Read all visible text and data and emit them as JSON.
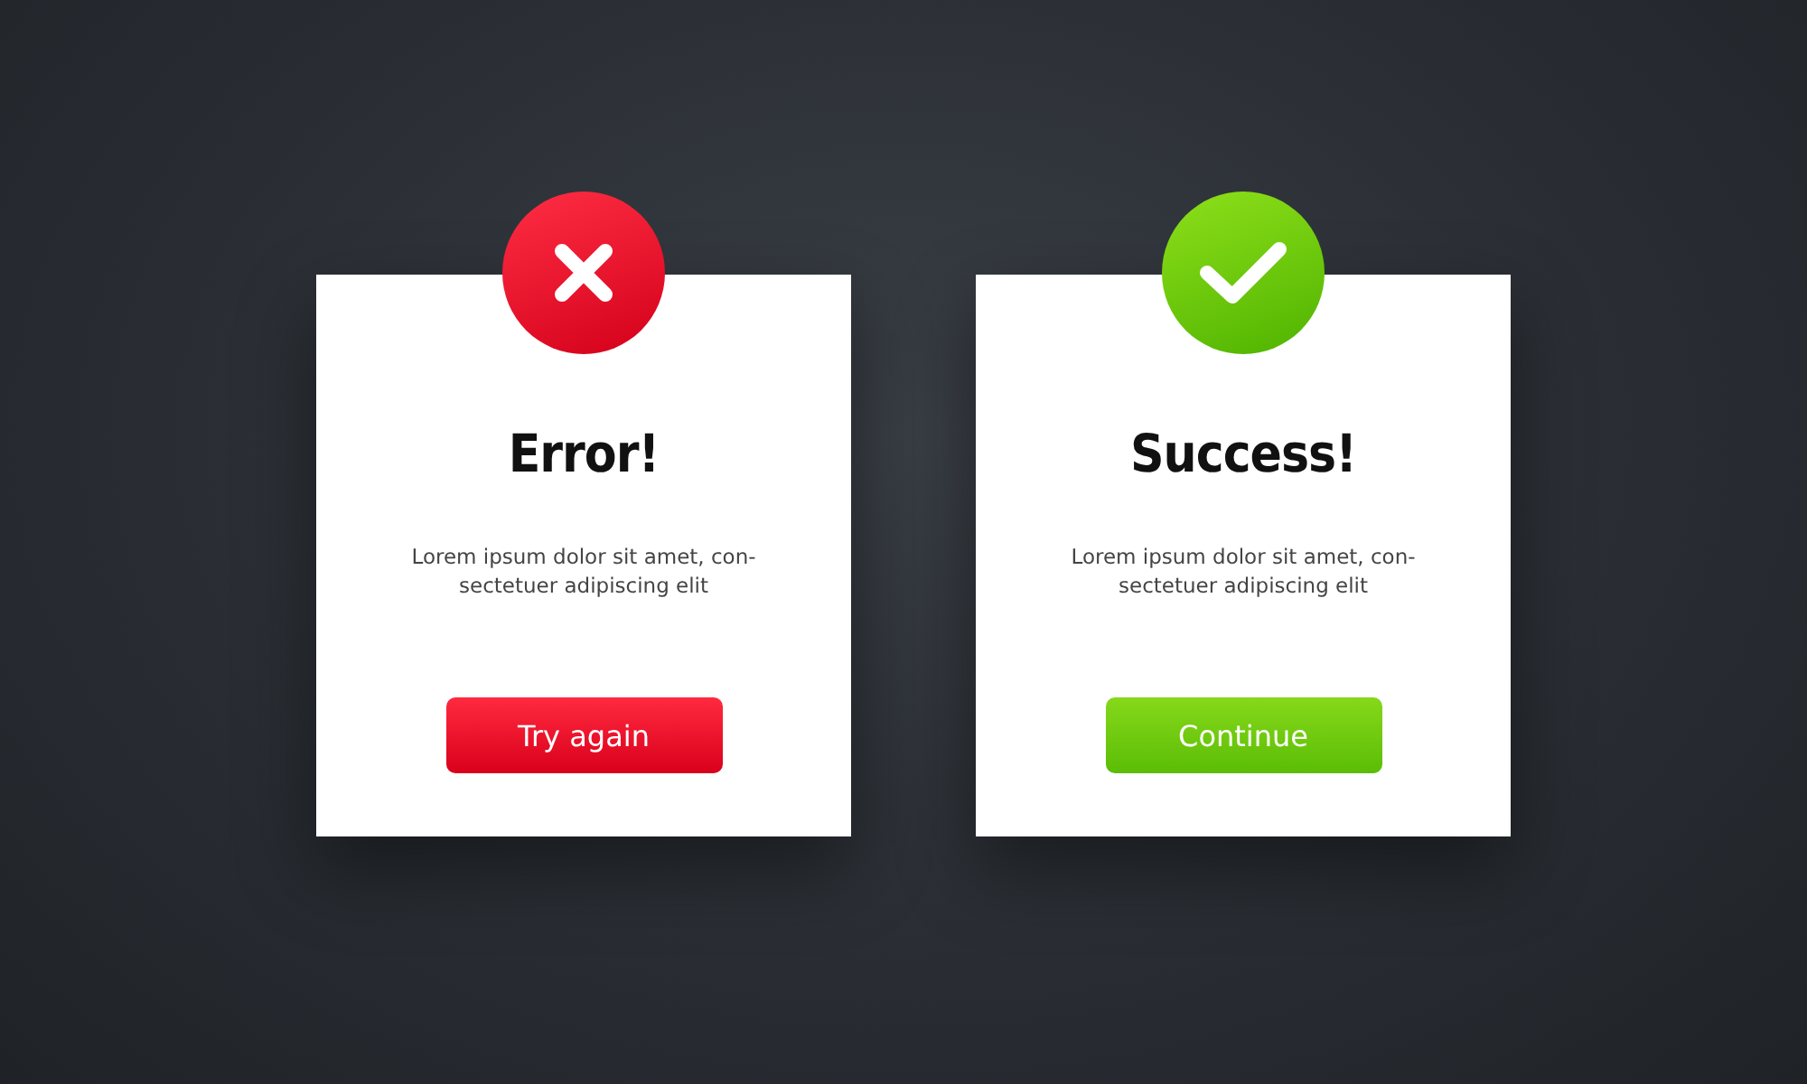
{
  "dialogs": [
    {
      "kind": "error",
      "title": "Error!",
      "message": "Lorem ipsum dolor sit amet, con-\nsectetuer adipiscing elit",
      "button": "Try again"
    },
    {
      "kind": "success",
      "title": "Success!",
      "message": "Lorem ipsum dolor sit amet, con-\nsectetuer adipiscing elit",
      "button": "Continue"
    }
  ]
}
